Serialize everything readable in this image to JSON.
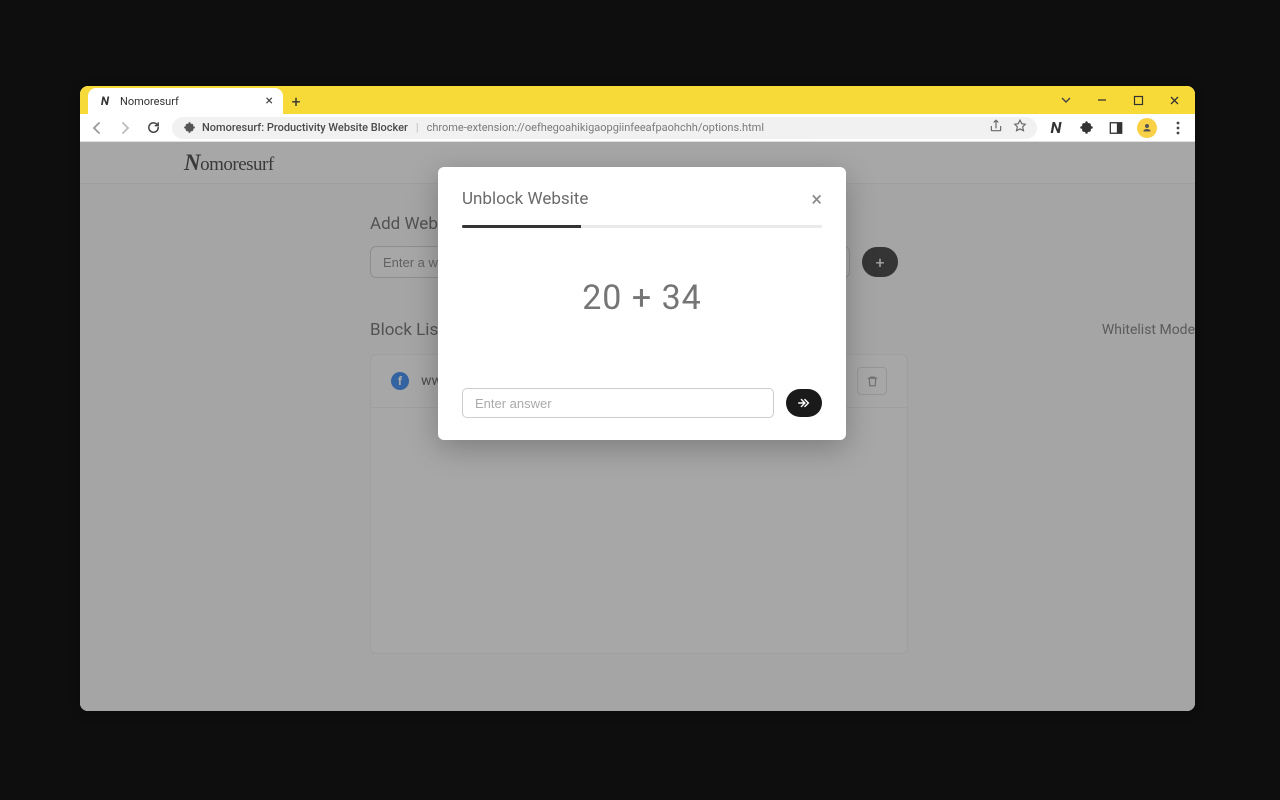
{
  "tab": {
    "title": "Nomoresurf"
  },
  "omnibox": {
    "title": "Nomoresurf: Productivity Website Blocker",
    "url": "chrome-extension://oefhegoahikigaopgiinfeeafpaohchh/options.html"
  },
  "brand": "Nomoresurf",
  "add_section": {
    "heading": "Add Website",
    "placeholder": "Enter a website URL"
  },
  "list_section": {
    "heading": "Block List",
    "whitelist_label": "Whitelist Mode"
  },
  "blocked_sites": [
    {
      "name": "www.facebook.com",
      "icon": "facebook"
    }
  ],
  "modal": {
    "title": "Unblock Website",
    "equation": "20 + 34",
    "answer_placeholder": "Enter answer",
    "progress_pct": 33
  }
}
